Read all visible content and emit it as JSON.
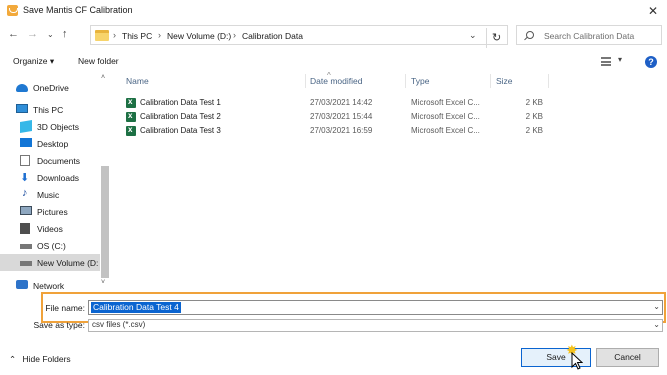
{
  "window": {
    "title": "Save Mantis CF Calibration",
    "close_label": "✕"
  },
  "address": {
    "back": "←",
    "forward": "→",
    "recent": "⌄",
    "up": "↑",
    "crumbs": [
      "This PC",
      "New Volume (D:)",
      "Calibration Data"
    ],
    "separator": "›",
    "dropdown": "⌄",
    "refresh": "↻"
  },
  "search": {
    "placeholder": "Search Calibration Data"
  },
  "toolbar": {
    "organize": "Organize ▾",
    "new_folder": "New folder",
    "view_dropdown": "▾",
    "help": "?"
  },
  "sidebar": {
    "items": [
      {
        "label": "OneDrive",
        "icon": "onedrive-icon"
      },
      {
        "label": "This PC",
        "icon": "pc-icon"
      },
      {
        "label": "3D Objects",
        "icon": "3d-objects-icon"
      },
      {
        "label": "Desktop",
        "icon": "desktop-icon"
      },
      {
        "label": "Documents",
        "icon": "documents-icon"
      },
      {
        "label": "Downloads",
        "icon": "downloads-icon"
      },
      {
        "label": "Music",
        "icon": "music-icon"
      },
      {
        "label": "Pictures",
        "icon": "pictures-icon"
      },
      {
        "label": "Videos",
        "icon": "videos-icon"
      },
      {
        "label": "OS (C:)",
        "icon": "drive-icon"
      },
      {
        "label": "New Volume (D:",
        "icon": "drive-icon"
      },
      {
        "label": "Network",
        "icon": "network-icon"
      }
    ],
    "scroll_up": "˄",
    "scroll_down": "˅"
  },
  "filelist": {
    "columns": [
      "Name",
      "Date modified",
      "Type",
      "Size"
    ],
    "sort_indicator": "^",
    "rows": [
      {
        "name": "Calibration Data Test 1",
        "date": "27/03/2021 14:42",
        "type": "Microsoft Excel C...",
        "size": "2 KB"
      },
      {
        "name": "Calibration Data Test 2",
        "date": "27/03/2021 15:44",
        "type": "Microsoft Excel C...",
        "size": "2 KB"
      },
      {
        "name": "Calibration Data Test 3",
        "date": "27/03/2021 16:59",
        "type": "Microsoft Excel C...",
        "size": "2 KB"
      }
    ]
  },
  "form": {
    "file_name_label": "File name:",
    "file_name_value": "Calibration Data Test 4",
    "save_type_label": "Save as type:",
    "save_type_value": "csv files (*.csv)",
    "dropdown": "⌄"
  },
  "footer": {
    "hide_folders": "Hide Folders",
    "hide_folders_chevron": "⌃",
    "save": "Save",
    "cancel": "Cancel"
  },
  "colors": {
    "accent": "#0a64d0",
    "highlight_frame": "#f0a23a",
    "excel": "#1d7044"
  }
}
